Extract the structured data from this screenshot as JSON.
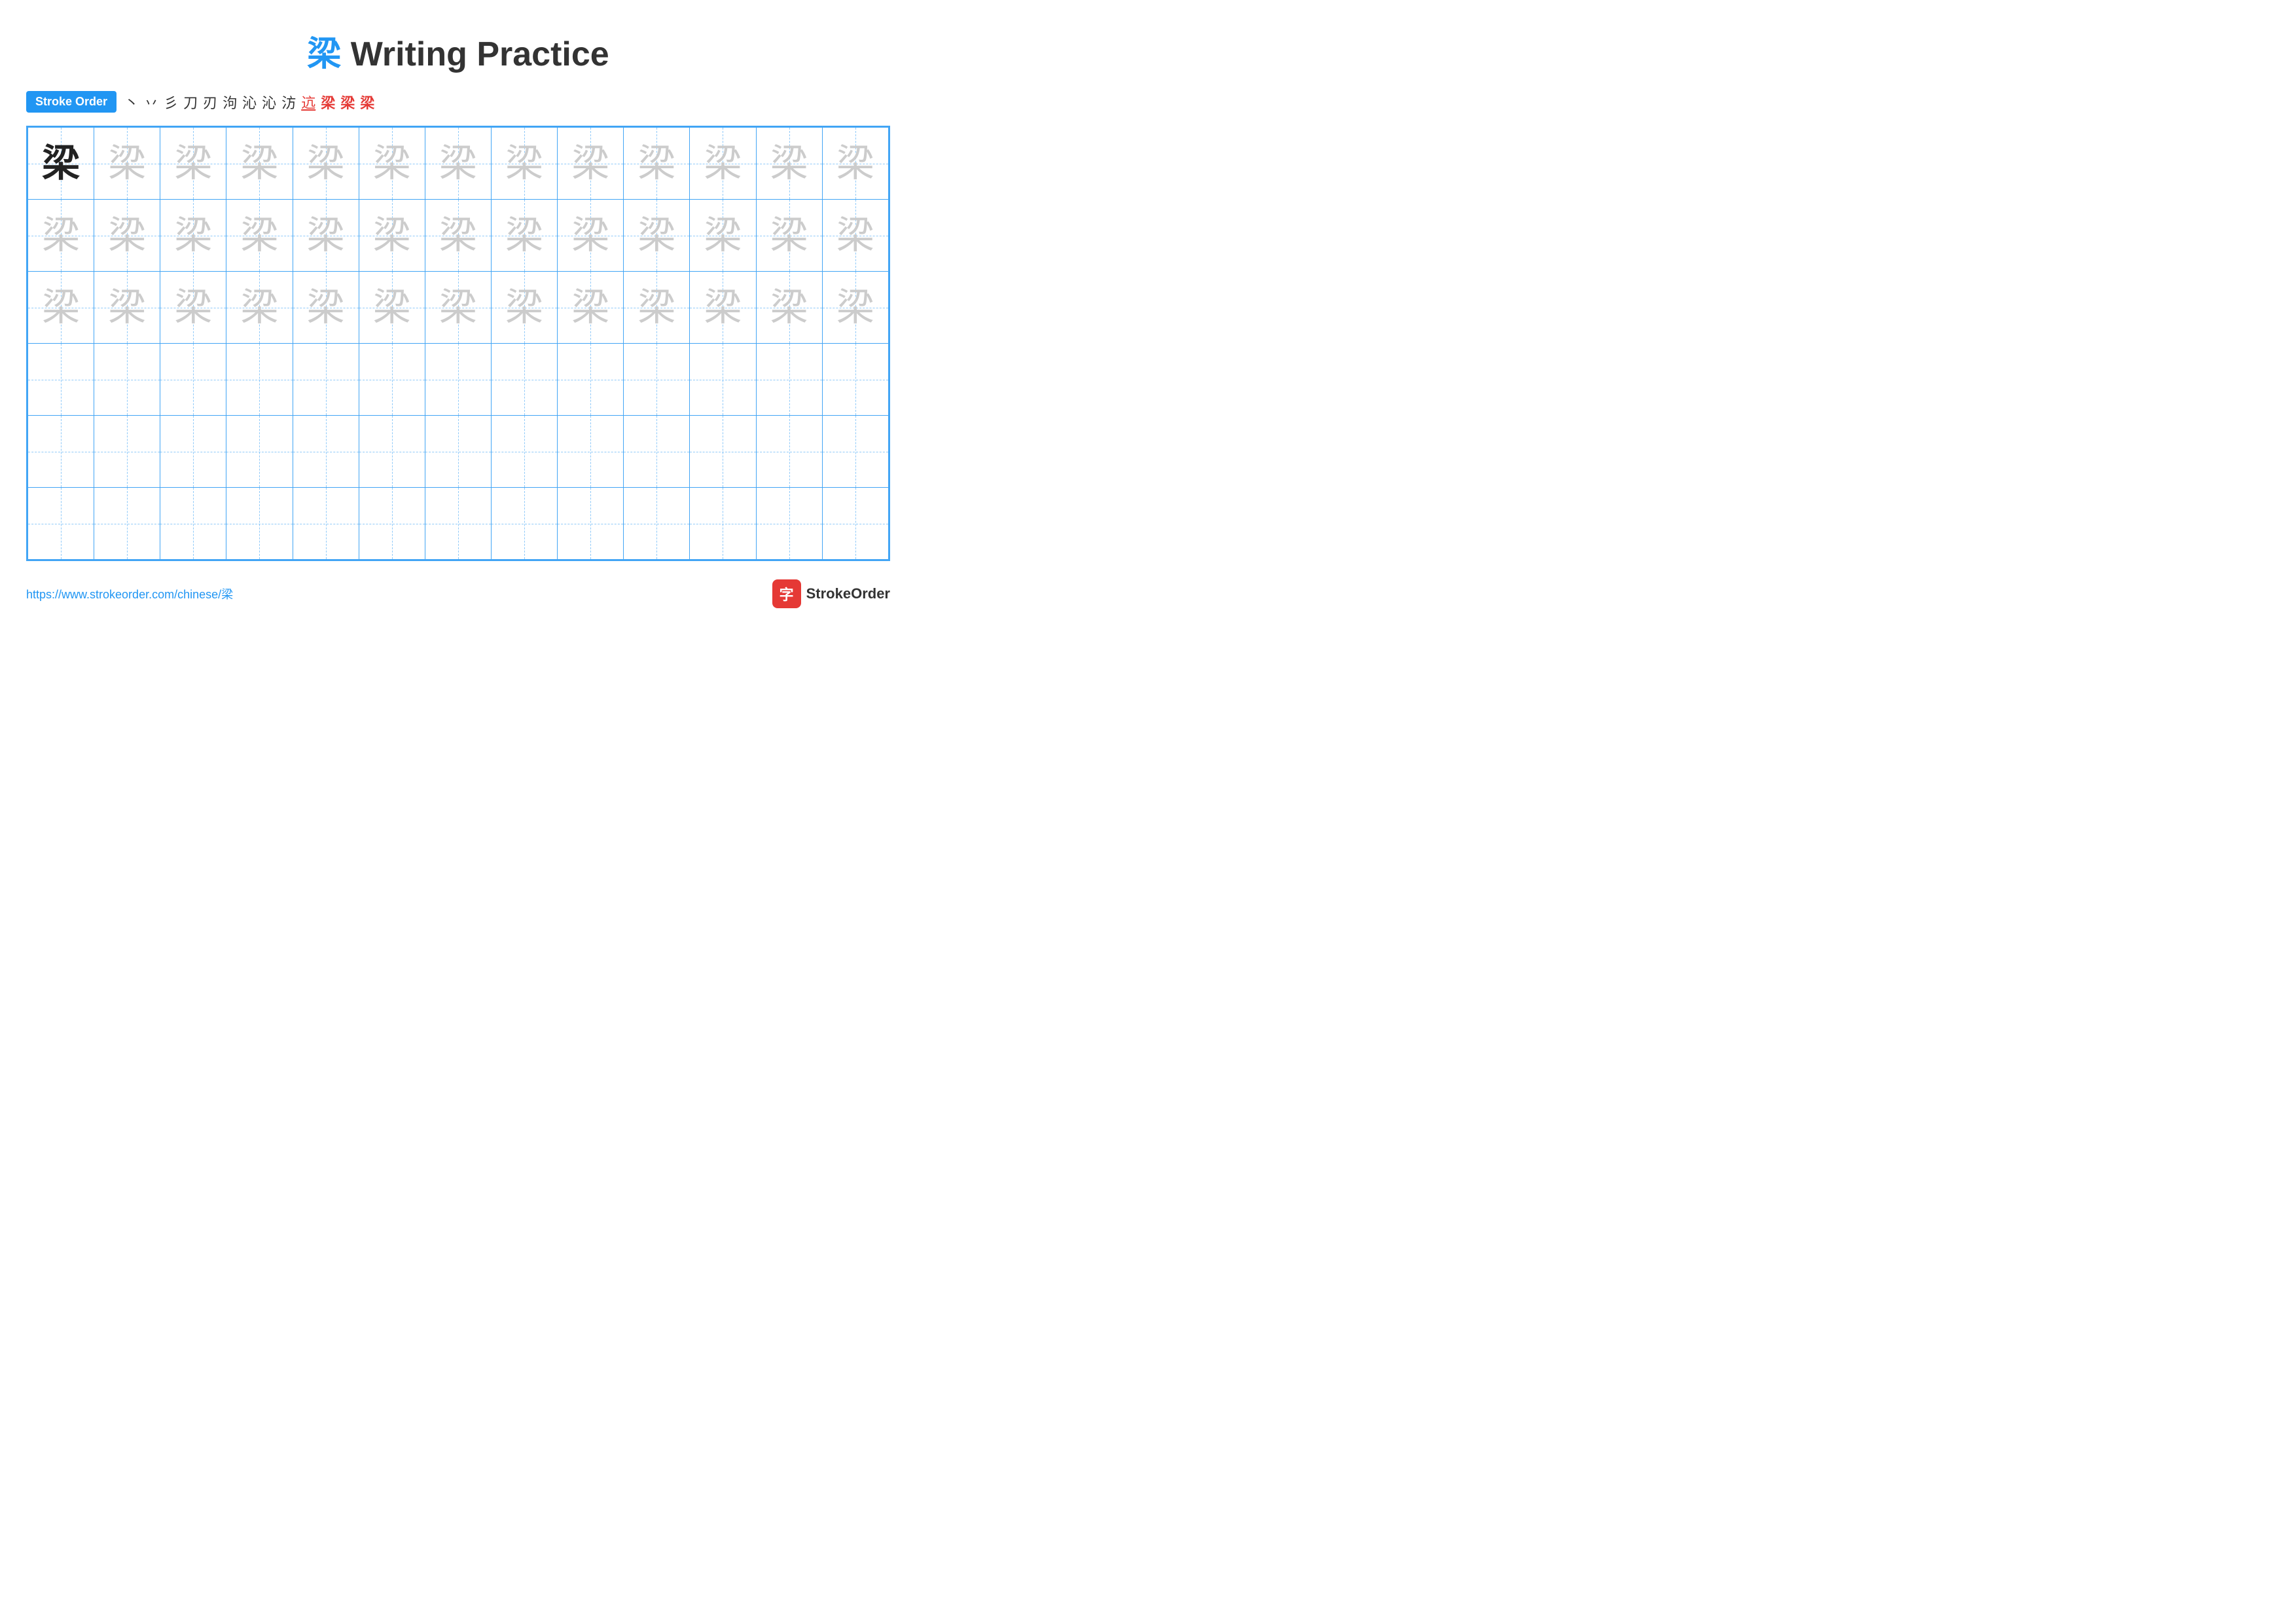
{
  "title": {
    "char": "梁",
    "rest": " Writing Practice"
  },
  "stroke_order": {
    "badge_label": "Stroke Order",
    "steps": [
      {
        "char": "丶",
        "style": "normal"
      },
      {
        "char": "丶",
        "style": "normal"
      },
      {
        "char": "彡",
        "style": "normal"
      },
      {
        "char": "刀",
        "style": "normal"
      },
      {
        "char": "刃",
        "style": "normal"
      },
      {
        "char": "刄",
        "style": "normal"
      },
      {
        "char": "沁",
        "style": "normal"
      },
      {
        "char": "沁",
        "style": "normal"
      },
      {
        "char": "沁",
        "style": "normal"
      },
      {
        "char": "迒",
        "style": "underline"
      },
      {
        "char": "梁",
        "style": "red"
      },
      {
        "char": "梁",
        "style": "red"
      },
      {
        "char": "梁",
        "style": "red"
      }
    ]
  },
  "grid": {
    "rows": 6,
    "cols": 13,
    "char": "梁",
    "practice_rows_with_char": 3,
    "empty_rows": 3
  },
  "footer": {
    "url": "https://www.strokeorder.com/chinese/梁",
    "brand_name": "StrokeOrder",
    "logo_char": "字"
  }
}
